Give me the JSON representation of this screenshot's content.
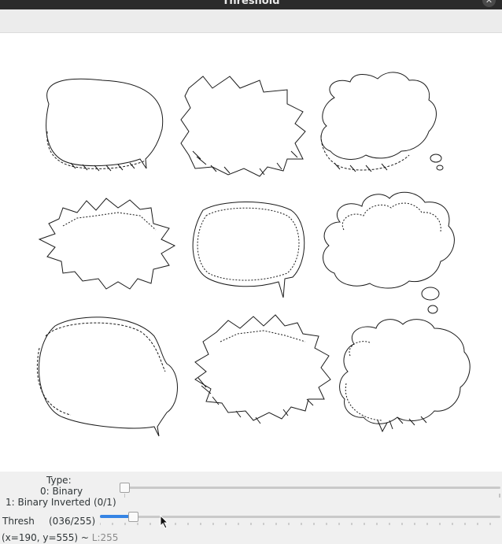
{
  "window": {
    "title": "Threshold"
  },
  "controls": {
    "type": {
      "label": "Type:",
      "option0": "0: Binary",
      "option1": "1: Binary Inverted (0/1)",
      "value": 0,
      "max": 1
    },
    "thresh": {
      "label": "Thresh",
      "readout": "(036/255)",
      "value": 36,
      "max": 255
    }
  },
  "status": {
    "coords": "(x=190, y=555) ~ ",
    "luminance": "L:255"
  },
  "icons": [
    "close-icon",
    "cursor-arrow-icon"
  ]
}
